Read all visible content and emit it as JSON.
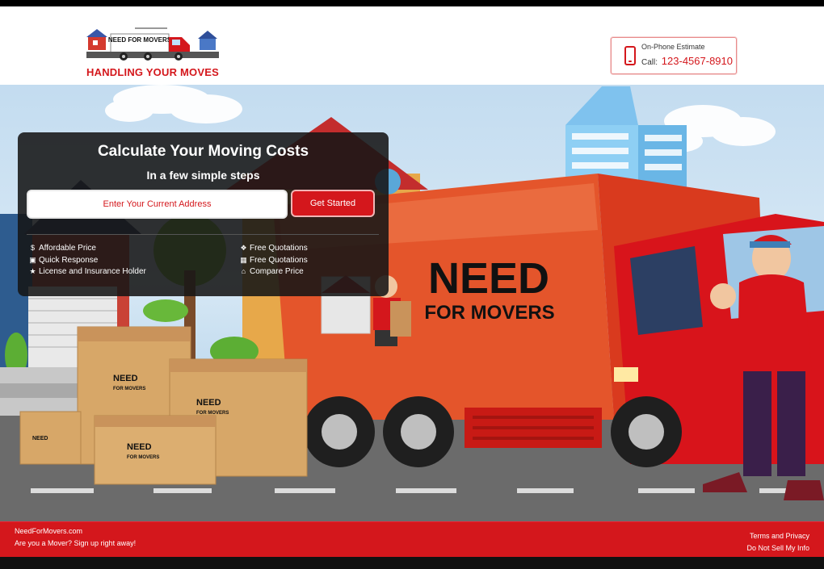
{
  "header": {
    "logo_text": "NEED FOR MOVERS",
    "logo_tagline": "HANDLING YOUR MOVES",
    "phone_label": "On-Phone Estimate",
    "phone_prefix": "Call:",
    "phone_number": "123-4567-8910"
  },
  "hero": {
    "truck_brand_big": "NEED",
    "truck_brand_small": "FOR MOVERS",
    "box_brand_big": "NEED",
    "box_brand_small": "FOR MOVERS"
  },
  "panel": {
    "title": "Calculate Your Moving Costs",
    "subtitle": "In a few simple steps",
    "address_placeholder": "Enter Your Current Address",
    "button_label": "Get Started",
    "features_left": [
      {
        "icon": "dollar-icon",
        "glyph": "$",
        "label": "Affordable Price"
      },
      {
        "icon": "id-card-icon",
        "glyph": "▣",
        "label": "Quick Response"
      },
      {
        "icon": "star-icon",
        "glyph": "★",
        "label": "License and Insurance Holder"
      }
    ],
    "features_right": [
      {
        "icon": "chat-icon",
        "glyph": "❖",
        "label": "Free Quotations"
      },
      {
        "icon": "gift-icon",
        "glyph": "▦",
        "label": "Free Quotations"
      },
      {
        "icon": "bank-icon",
        "glyph": "⌂",
        "label": "Compare Price"
      }
    ]
  },
  "footer": {
    "site": "NeedForMovers.com",
    "signup": "Are you a Mover? Sign up right away!",
    "terms": "Terms and Privacy",
    "do_not_sell": "Do Not Sell My Info"
  },
  "colors": {
    "brand_red": "#d4171c",
    "panel_bg": "#161616",
    "sky": "#c3dcf0"
  }
}
